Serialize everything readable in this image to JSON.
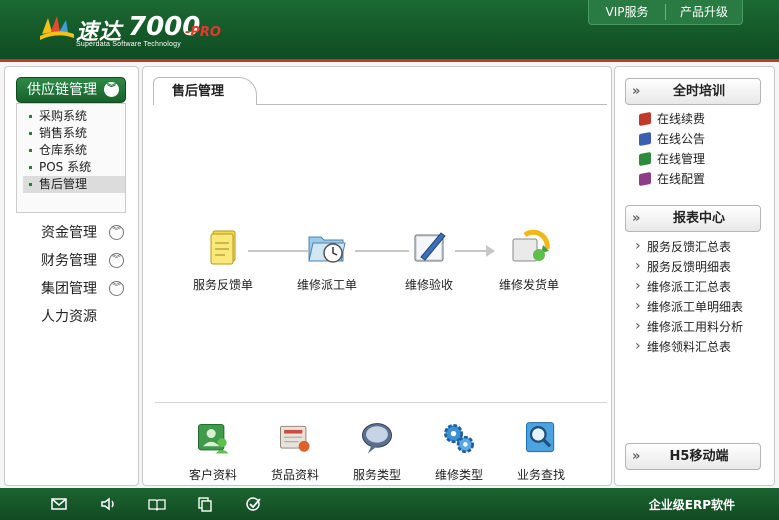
{
  "header": {
    "brand_cn": "速达",
    "brand_num": "7000",
    "brand_pro": "-PRO",
    "brand_en": "Superdata Software Technology",
    "links": [
      "VIP服务",
      "产品升级"
    ]
  },
  "sidebar": {
    "active_group": "供应链管理",
    "sub_items": [
      "采购系统",
      "销售系统",
      "仓库系统",
      "POS 系统",
      "售后管理"
    ],
    "active_sub": "售后管理",
    "groups": [
      "资金管理",
      "财务管理",
      "集团管理",
      "人力资源"
    ]
  },
  "main": {
    "tab": "售后管理",
    "flow": [
      "服务反馈单",
      "维修派工单",
      "维修验收",
      "维修发货单"
    ],
    "bottom": [
      "客户资料",
      "货品资料",
      "服务类型",
      "维修类型",
      "业务查找"
    ]
  },
  "right": {
    "training": {
      "title": "全时培训",
      "items": [
        "在线续费",
        "在线公告",
        "在线管理",
        "在线配置"
      ]
    },
    "reports": {
      "title": "报表中心",
      "items": [
        "服务反馈汇总表",
        "服务反馈明细表",
        "维修派工汇总表",
        "维修派工单明细表",
        "维修派工用料分析",
        "维修领料汇总表"
      ]
    },
    "mobile": "H5移动端"
  },
  "footer": {
    "text": "企业级ERP软件",
    "icons": [
      "mail-icon",
      "speaker-icon",
      "book-icon",
      "copy-icon",
      "check-icon"
    ]
  },
  "colors": {
    "brand_green": "#0f4a21",
    "accent_red": "#c0392b"
  }
}
